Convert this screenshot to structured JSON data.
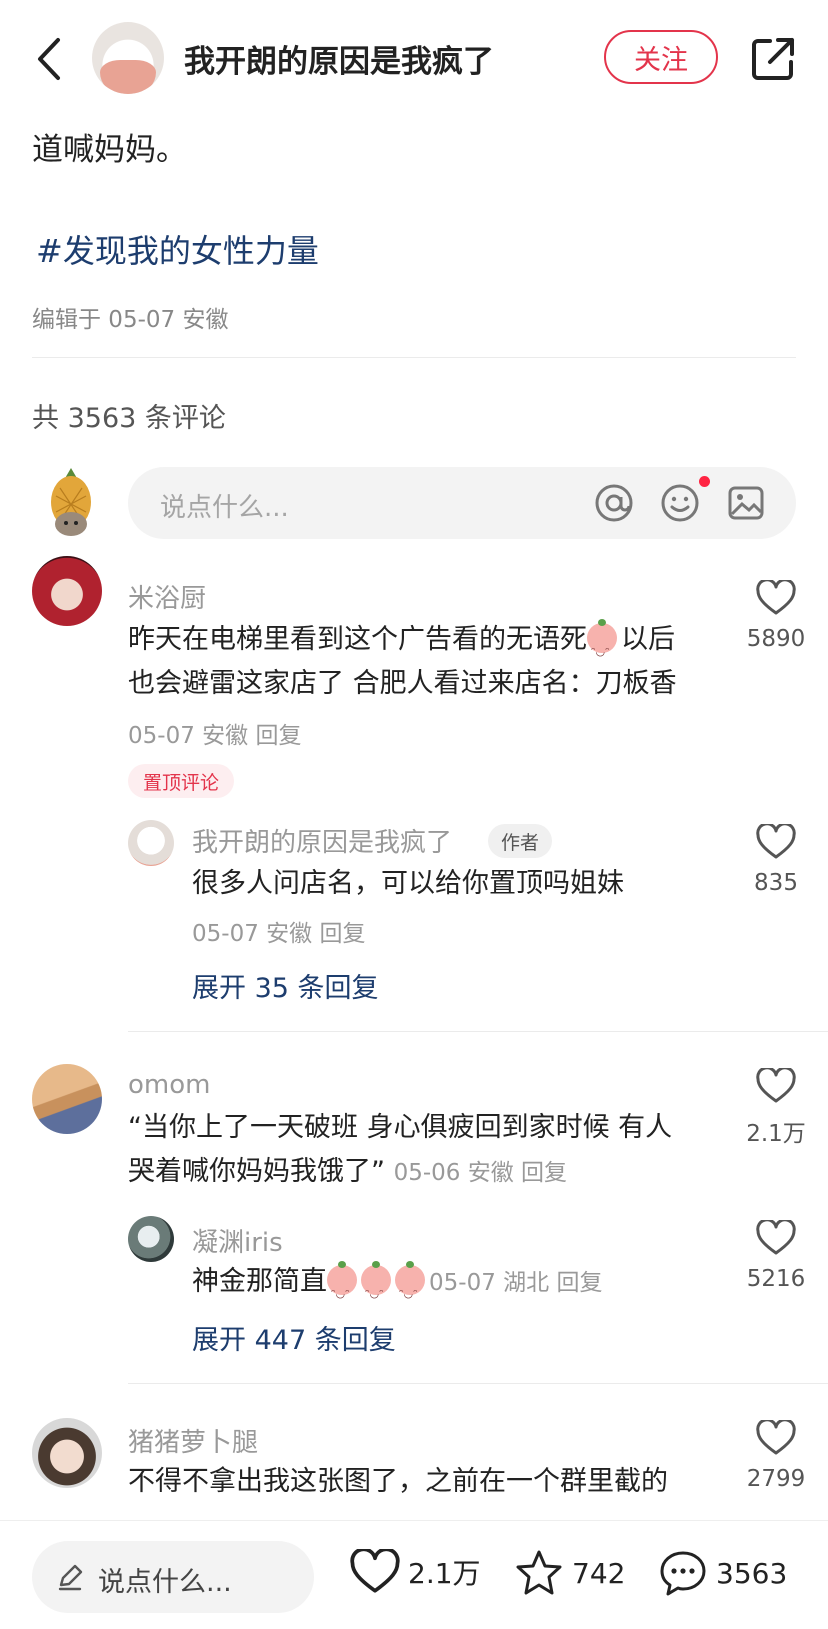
{
  "header": {
    "title": "我开朗的原因是我疯了",
    "follow_label": "关注"
  },
  "post": {
    "text_tail": "道喊妈妈。",
    "tag": "#发现我的女性力量",
    "edited": "编辑于 05-07 安徽"
  },
  "comments_count": "共 3563 条评论",
  "input": {
    "placeholder": "说点什么..."
  },
  "comments": [
    {
      "user": "米浴厨",
      "line1": "昨天在电梯里看到这个广告看的无语死",
      "line1_tail": "以后",
      "line2": "也会避雷这家店了 合肥人看过来店名：刀板香",
      "meta": "05-07 安徽 回复",
      "likes": "5890",
      "pin_label": "置顶评论",
      "reply": {
        "user": "我开朗的原因是我疯了",
        "author_tag": "作者",
        "text": "很多人问店名，可以给你置顶吗姐妹",
        "meta": "05-07 安徽 回复",
        "likes": "835"
      },
      "expand": "展开 35 条回复"
    },
    {
      "user": "omom",
      "line1": "“当你上了一天破班 身心俱疲回到家时候 有人",
      "line2": "哭着喊你妈妈我饿了”",
      "meta": "05-06 安徽 回复",
      "likes": "2.1万",
      "reply": {
        "user": "凝渊iris",
        "text": "神金那简直",
        "meta": "05-07 湖北 回复",
        "likes": "5216"
      },
      "expand": "展开 447 条回复"
    },
    {
      "user": "猪猪萝卜腿",
      "line1": "不得不拿出我这张图了，之前在一个群里截的",
      "likes": "2799"
    }
  ],
  "bottom": {
    "placeholder": "说点什么...",
    "likes": "2.1万",
    "stars": "742",
    "comments": "3563"
  },
  "icons": {
    "back": "chevron-left-icon",
    "share": "share-icon",
    "mention": "at-icon",
    "emoji": "emoji-icon",
    "image": "image-icon",
    "like": "heart-icon",
    "star": "star-icon",
    "comment": "chat-bubble-icon",
    "edit": "pencil-icon"
  },
  "colors": {
    "accent": "#e3344b",
    "link": "#1d3d6e"
  }
}
